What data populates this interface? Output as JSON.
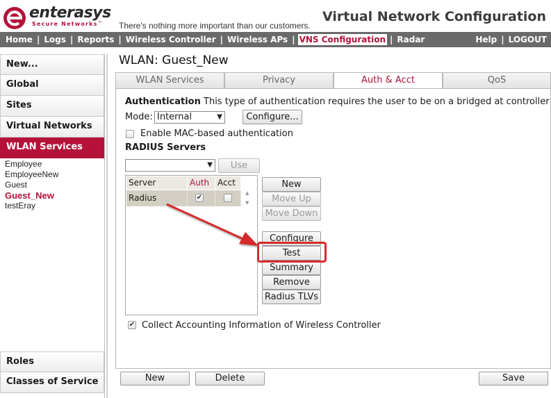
{
  "brand": {
    "name": "enterasys",
    "sub": "Secure Networks",
    "trademark": "™",
    "tagline": "There's nothing more important than our customers."
  },
  "app_title": "Virtual Network Configuration",
  "nav": {
    "items": [
      "Home",
      "Logs",
      "Reports",
      "Wireless Controller",
      "Wireless APs",
      "VNS Configuration",
      "Radar"
    ],
    "active": "VNS Configuration",
    "right": [
      "Help",
      "LOGOUT"
    ]
  },
  "sidebar": {
    "top_items": [
      "New...",
      "Global",
      "Sites",
      "Virtual Networks",
      "WLAN Services"
    ],
    "active_item": "WLAN Services",
    "wlan_list": [
      "Employee",
      "EmployeeNew",
      "Guest",
      "Guest_New",
      "testEray"
    ],
    "active_wlan": "Guest_New",
    "bottom_items": [
      "Roles",
      "Classes of Service"
    ]
  },
  "page_title": "WLAN: Guest_New",
  "tabs": [
    "WLAN Services",
    "Privacy",
    "Auth & Acct",
    "QoS"
  ],
  "active_tab": "Auth & Acct",
  "auth": {
    "heading": "Authentication",
    "description": "This type of authentication requires the user to be on a bridged at controller or routed",
    "mode_label": "Mode:",
    "mode_value": "Internal",
    "configure_label": "Configure...",
    "mac_auth_label": "Enable MAC-based authentication",
    "mac_auth_checked": false
  },
  "radius": {
    "title": "RADIUS Servers",
    "select_value": "",
    "use_label": "Use",
    "columns": [
      "Server",
      "Auth",
      "Acct"
    ],
    "rows": [
      {
        "server": "Radius",
        "auth": true,
        "acct": false
      }
    ],
    "buttons": [
      "New",
      "Move Up",
      "Move Down",
      "Configure",
      "Test",
      "Summary",
      "Remove",
      "Radius TLVs"
    ],
    "disabled_buttons": [
      "Move Up",
      "Move Down"
    ]
  },
  "collect_label": "Collect Accounting Information of Wireless Controller",
  "collect_checked": true,
  "footer": {
    "new_label": "New",
    "delete_label": "Delete",
    "save_label": "Save"
  },
  "annotation": {
    "highlighted_button": "Test",
    "highlight_color": "#d42b2b"
  },
  "colors": {
    "brand": "#b5123a",
    "nav_bg": "#6a6a6a",
    "row_selected": "#d4cfc4"
  },
  "icons": [
    "enterasys-logo-icon",
    "dropdown-arrow-icon",
    "checkmark-icon",
    "scroll-up-icon",
    "scroll-down-icon",
    "pointer-arrow-icon"
  ]
}
